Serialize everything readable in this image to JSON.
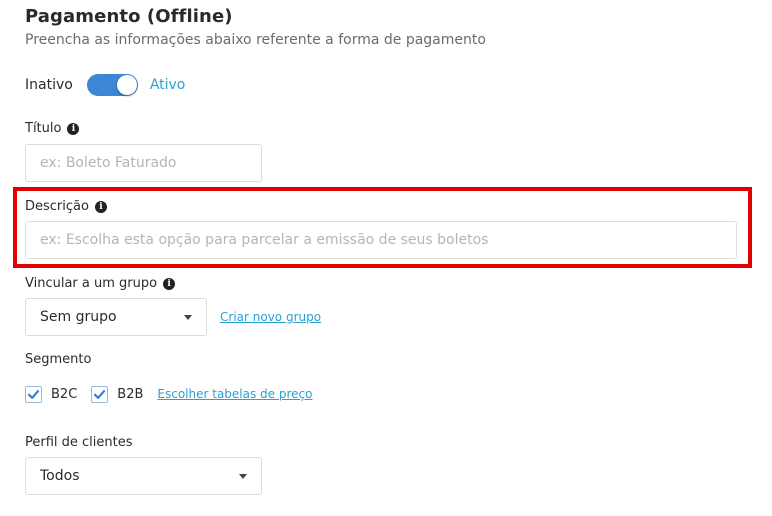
{
  "header": {
    "title": "Pagamento (Offline)",
    "subtitle": "Preencha as informações abaixo referente a forma de pagamento"
  },
  "status_toggle": {
    "off_label": "Inativo",
    "on_label": "Ativo",
    "checked": true
  },
  "titulo": {
    "label": "Título",
    "placeholder": "ex: Boleto Faturado",
    "value": ""
  },
  "descricao": {
    "label": "Descrição",
    "placeholder": "ex: Escolha esta opção para parcelar a emissão de seus boletos",
    "value": ""
  },
  "grupo": {
    "label": "Vincular a um grupo",
    "selected": "Sem grupo",
    "create_link": "Criar novo grupo"
  },
  "segmento": {
    "label": "Segmento",
    "options": [
      {
        "label": "B2C",
        "checked": true
      },
      {
        "label": "B2B",
        "checked": true
      }
    ],
    "price_tables_link": "Escolher tabelas de preço"
  },
  "perfil": {
    "label": "Perfil de clientes",
    "selected": "Todos"
  },
  "colors": {
    "accent": "#3d86d6",
    "link": "#2aa1d6",
    "highlight": "#e00000"
  }
}
